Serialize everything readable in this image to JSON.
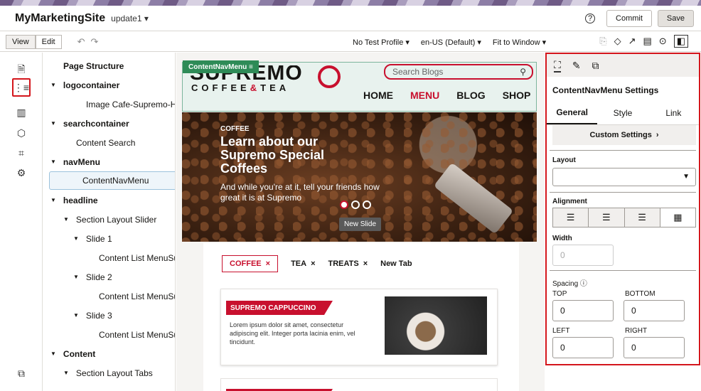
{
  "app": {
    "site_name": "MyMarketingSite",
    "version": "update1 ▾",
    "help_icon": "?",
    "commit_label": "Commit",
    "save_label": "Save"
  },
  "toolbar": {
    "view_label": "View",
    "edit_label": "Edit",
    "undo": "↶",
    "redo": "↷",
    "profile": "No Test Profile ▾",
    "locale": "en-US (Default) ▾",
    "fit": "Fit to Window ▾"
  },
  "rail": {
    "items": [
      "pages-icon",
      "tree-icon",
      "columns-icon",
      "component-icon",
      "crop-icon",
      "settings-icon",
      "bottom-icon"
    ]
  },
  "tree": {
    "items": [
      {
        "label": "Page Structure",
        "level": 0,
        "caret": "",
        "bold": true
      },
      {
        "label": "logocontainer",
        "level": 0,
        "caret": "▼",
        "bold": true
      },
      {
        "label": "Image Cafe-Supremo-Header",
        "level": 2,
        "caret": "",
        "bold": false
      },
      {
        "label": "searchcontainer",
        "level": 0,
        "caret": "▼",
        "bold": true
      },
      {
        "label": "Content Search",
        "level": 1,
        "caret": "",
        "bold": false
      },
      {
        "label": "navMenu",
        "level": 0,
        "caret": "▼",
        "bold": true
      },
      {
        "label": "ContentNavMenu",
        "level": 1,
        "caret": "",
        "bold": false,
        "selected": true
      },
      {
        "label": "headline",
        "level": 0,
        "caret": "▼",
        "bold": true
      },
      {
        "label": "Section Layout Slider",
        "level": 1,
        "caret": "▼",
        "bold": false
      },
      {
        "label": "Slide 1",
        "level": 2,
        "caret": "▼",
        "bold": false
      },
      {
        "label": "Content List MenuSu",
        "level": 3,
        "caret": "",
        "bold": false
      },
      {
        "label": "Slide 2",
        "level": 2,
        "caret": "▼",
        "bold": false
      },
      {
        "label": "Content List MenuSu",
        "level": 3,
        "caret": "",
        "bold": false
      },
      {
        "label": "Slide 3",
        "level": 2,
        "caret": "▼",
        "bold": false
      },
      {
        "label": "Content List MenuSu",
        "level": 3,
        "caret": "",
        "bold": false
      },
      {
        "label": "Content",
        "level": 0,
        "caret": "▼",
        "bold": true
      },
      {
        "label": "Section Layout Tabs",
        "level": 1,
        "caret": "▼",
        "bold": false
      }
    ]
  },
  "canvas": {
    "badge": "ContentNavMenu ≡",
    "logo_top": "SUPREMO",
    "logo_bottom_a": "COFFEE",
    "logo_bottom_b": "&",
    "logo_bottom_c": "TEA",
    "search_placeholder": "Search Blogs",
    "nav": [
      "HOME",
      "MENU",
      "BLOG",
      "SHOP"
    ],
    "hero": {
      "category": "COFFEE",
      "title": "Learn about our Supremo Special Coffees",
      "subtitle": "And while you're at it, tell your friends how great it is at Supremo",
      "button": "New Slide"
    },
    "tabs": [
      {
        "label": "COFFEE",
        "x": "×"
      },
      {
        "label": "TEA",
        "x": "×"
      },
      {
        "label": "TREATS",
        "x": "×"
      },
      {
        "label": "New Tab",
        "x": ""
      }
    ],
    "card": {
      "tag": "SUPREMO CAPPUCCINO",
      "text": "Lorem ipsum dolor sit amet, consectetur adipiscing elit. Integer porta lacinia enim, vel tincidunt."
    }
  },
  "panel": {
    "title": "ContentNavMenu Settings",
    "tabs": [
      "General",
      "Style",
      "Link"
    ],
    "custom": "Custom Settings",
    "layout_label": "Layout",
    "alignment_label": "Alignment",
    "width_label": "Width",
    "width_value": "0",
    "spacing_label": "Spacing ⓘ",
    "top_label": "TOP",
    "bottom_label": "BOTTOM",
    "left_label": "LEFT",
    "right_label": "RIGHT",
    "top": "0",
    "bottom": "0",
    "left": "0",
    "right": "0"
  },
  "colors": {
    "accent": "#c8102e",
    "selection": "#d4161c",
    "badge": "#2e8b57"
  }
}
